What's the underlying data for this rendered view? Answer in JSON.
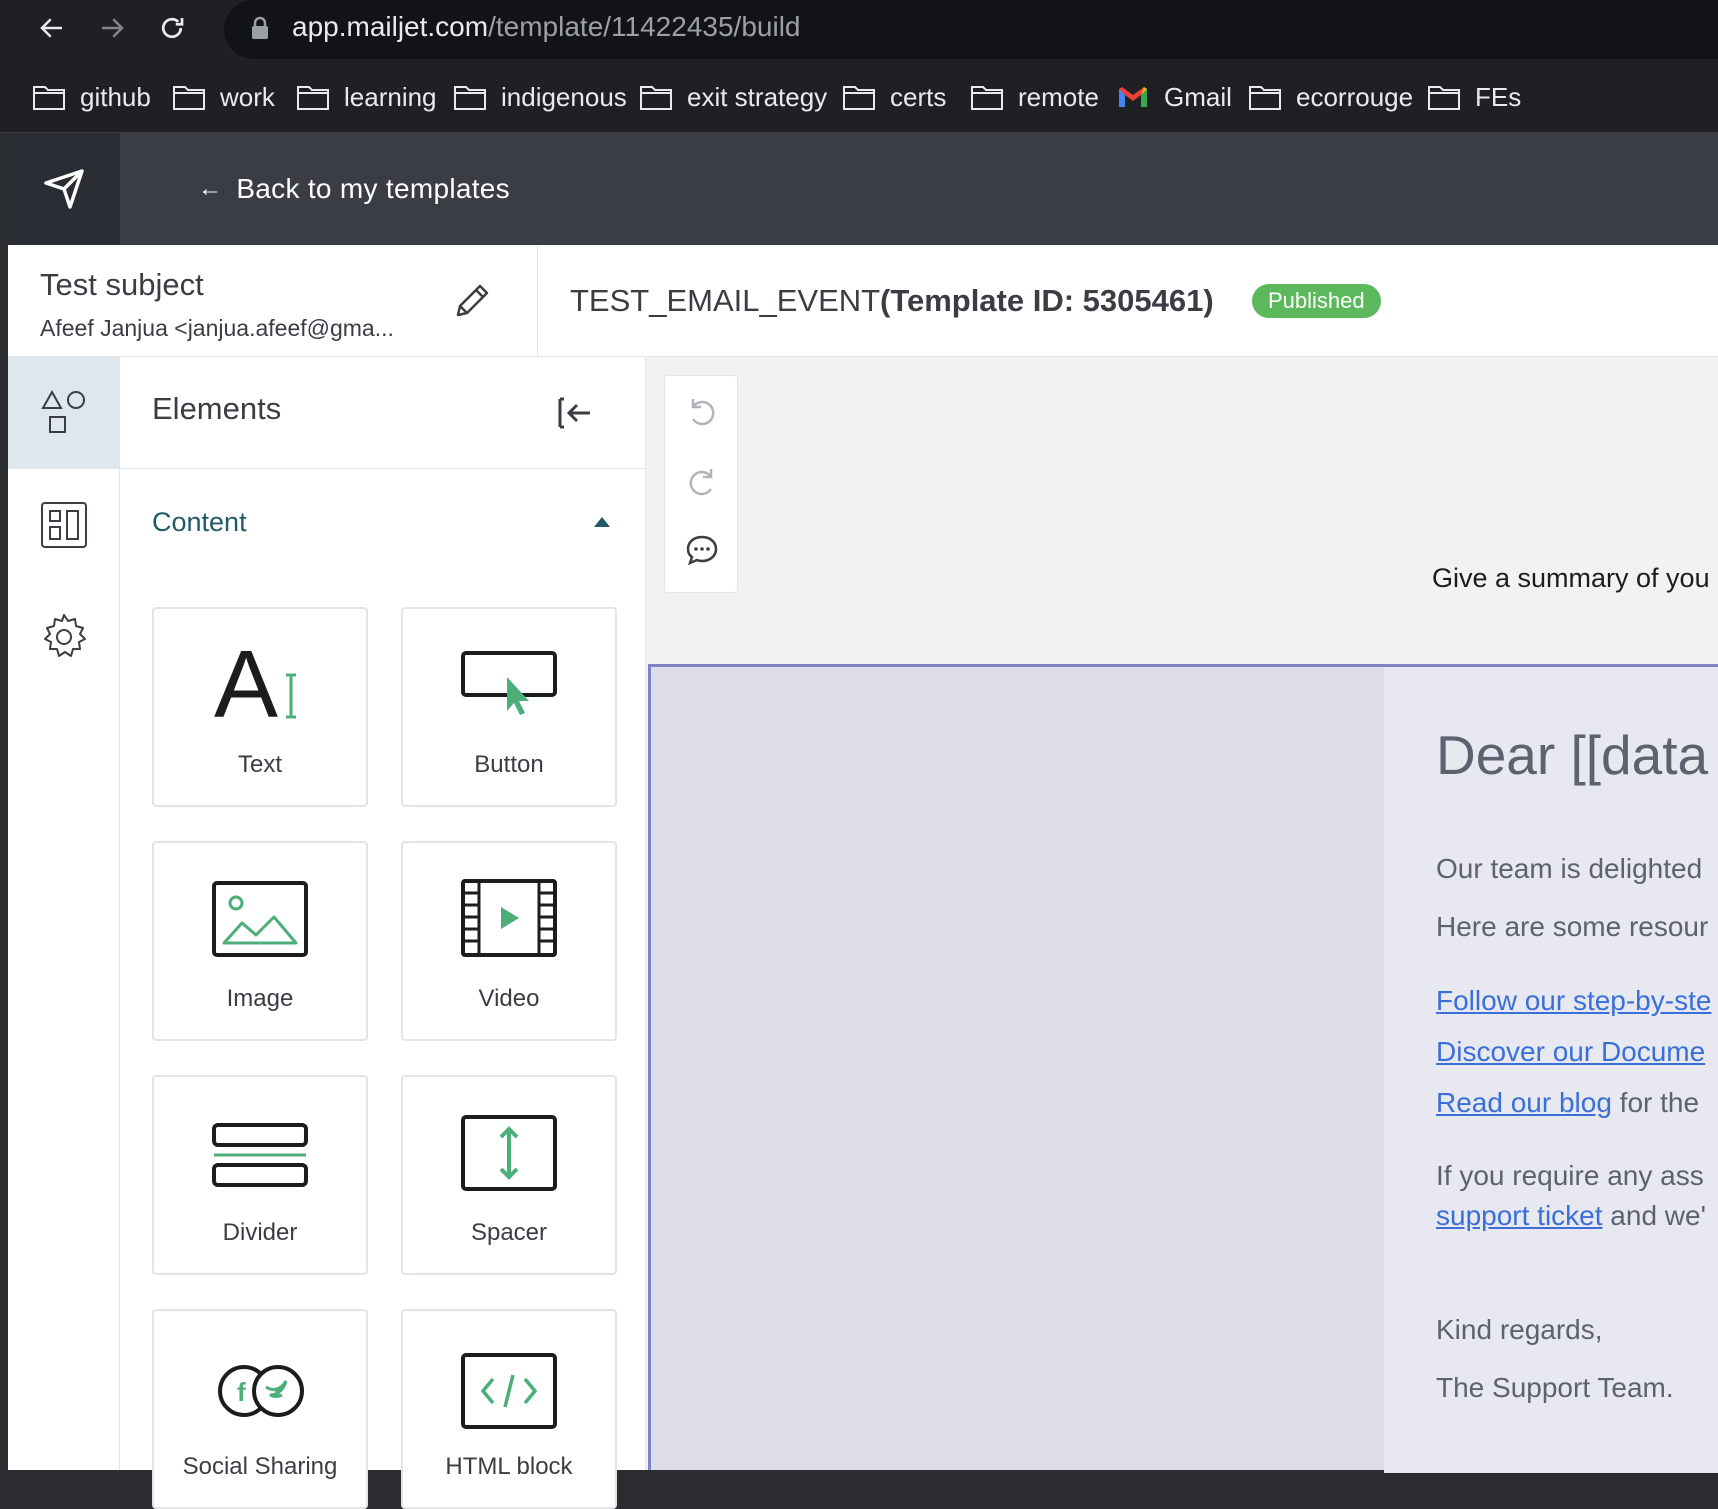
{
  "browser": {
    "url_host": "app.mailjet.com",
    "url_path": "/template/11422435/build",
    "bookmarks": [
      {
        "label": "github",
        "icon": "folder-icon"
      },
      {
        "label": "work",
        "icon": "folder-icon"
      },
      {
        "label": "learning",
        "icon": "folder-icon"
      },
      {
        "label": "indigenous",
        "icon": "folder-icon"
      },
      {
        "label": "exit strategy",
        "icon": "folder-icon"
      },
      {
        "label": "certs",
        "icon": "folder-icon"
      },
      {
        "label": "remote",
        "icon": "folder-icon"
      },
      {
        "label": "Gmail",
        "icon": "gmail-icon"
      },
      {
        "label": "ecorrouge",
        "icon": "folder-icon"
      },
      {
        "label": "FEs",
        "icon": "folder-icon"
      }
    ]
  },
  "header": {
    "back_label": "Back to my templates"
  },
  "subject": {
    "title": "Test subject",
    "from": "Afeef Janjua <janjua.afeef@gma..."
  },
  "template": {
    "name": "TEST_EMAIL_EVENT",
    "id_label": "(Template ID: 5305461)",
    "status": "Published"
  },
  "panel": {
    "title": "Elements",
    "section_label": "Content",
    "tiles": [
      {
        "label": "Text",
        "icon": "text-icon"
      },
      {
        "label": "Button",
        "icon": "button-icon"
      },
      {
        "label": "Image",
        "icon": "image-icon"
      },
      {
        "label": "Video",
        "icon": "video-icon"
      },
      {
        "label": "Divider",
        "icon": "divider-icon"
      },
      {
        "label": "Spacer",
        "icon": "spacer-icon"
      },
      {
        "label": "Social Sharing",
        "icon": "social-sharing-icon"
      },
      {
        "label": "HTML block",
        "icon": "html-block-icon"
      }
    ]
  },
  "canvas": {
    "summary": "Give a summary of you",
    "greeting": "Dear [[data",
    "line1": "Our team is delighted",
    "line2": "Here are some resour",
    "link1": "Follow our step-by-ste",
    "link2": "Discover our Docume",
    "link3": "Read our blog",
    "link3_suffix": " for the",
    "line3": "If you require any ass",
    "link4": "support ticket",
    "link4_suffix": " and we'",
    "closing": "Kind regards,",
    "signature": "The Support Team."
  },
  "colors": {
    "accent_green": "#5cb85c",
    "link_blue": "#3b6fd8",
    "teal_label": "#1f5a69",
    "selection_border": "#7f84c6"
  }
}
